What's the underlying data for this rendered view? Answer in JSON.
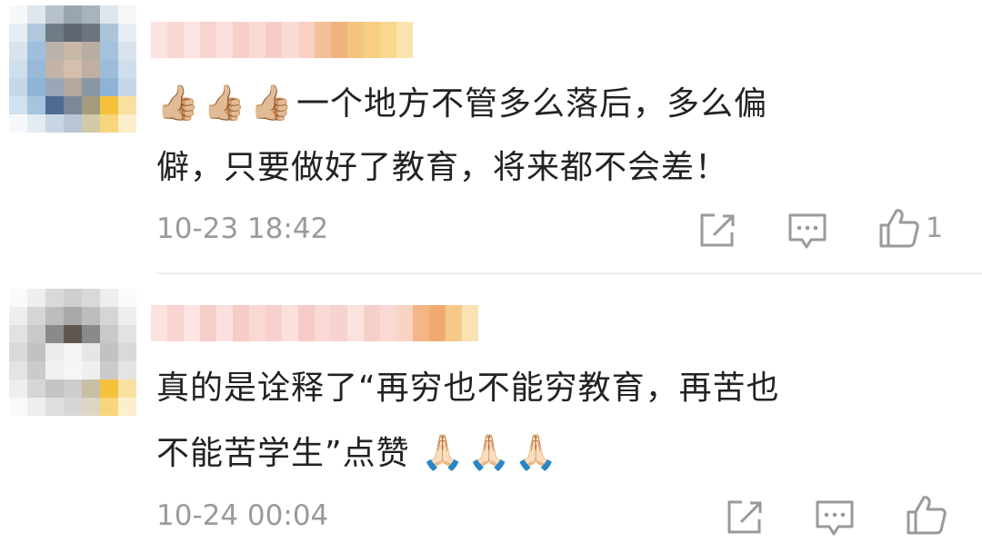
{
  "comments": [
    {
      "text_line1": "一个地方不管多么落后，多么偏",
      "text_line2": "僻，只要做好了教育，将来都不会差！",
      "emoji_prefix": "👍🏼👍🏼👍🏼",
      "time": "10-23 18:42",
      "like_count": "1"
    },
    {
      "text_line1": "真的是诠释了“再穷也不能穷教育，再苦也",
      "text_line2": "不能苦学生”点赞",
      "emoji_suffix": "🙏🏻🙏🏻🙏🏻",
      "time": "10-24 00:04",
      "like_count": ""
    }
  ],
  "icons": {
    "share": "share-icon",
    "reply": "reply-icon",
    "like": "thumbs-up-icon"
  },
  "colors": {
    "text": "#222222",
    "meta": "#9a9a9a",
    "divider": "#eeeeee"
  }
}
